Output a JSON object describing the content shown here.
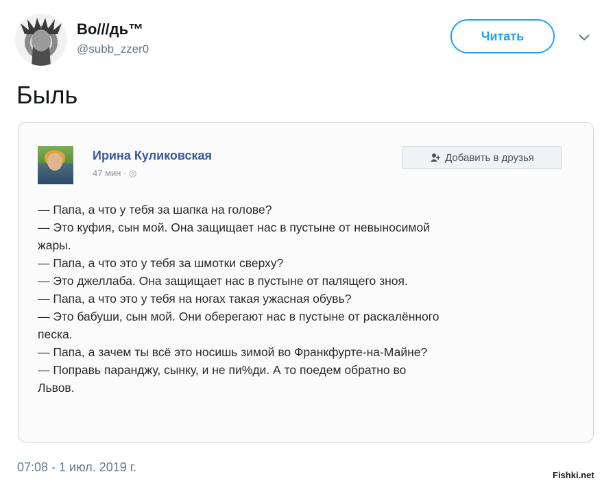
{
  "header": {
    "display_name": "Во///дь™",
    "handle": "@subb_zzer0",
    "follow_label": "Читать"
  },
  "tweet": {
    "text": "Быль",
    "timestamp": "07:08 - 1 июл. 2019 г."
  },
  "embedded_post": {
    "author": "Ирина Куликовская",
    "meta": "47 мин · ◎",
    "add_friend_label": "Добавить в друзья",
    "lines": [
      "— Папа, а что у тебя за шапка на голове?",
      "— Это куфия, сын мой. Она защищает нас в пустыне от невыносимой",
      "жары.",
      "— Папа, а что это у тебя за шмотки сверху?",
      "— Это джеллаба. Она защищает нас в пустыне от палящего зноя.",
      "— Папа, а что это у тебя на ногах такая ужасная обувь?",
      "— Это бабуши, сын мой. Они оберегают нас в пустыне от раскалённого",
      "песка.",
      "— Папа, а зачем ты всё это носишь зимой во Франкфурте-на-Майне?",
      "— Поправь паранджу, сынку, и не пи%ди. А то поедем обратно во",
      "Львов."
    ]
  },
  "watermark": "Fishki.net",
  "colors": {
    "twitter_blue": "#1da1f2",
    "facebook_blue": "#3b5998",
    "muted_gray": "#657786"
  },
  "icons": {
    "avatar": "user-avatar-portrait",
    "caret": "chevron-down-icon",
    "add_friend": "add-friend-icon"
  }
}
